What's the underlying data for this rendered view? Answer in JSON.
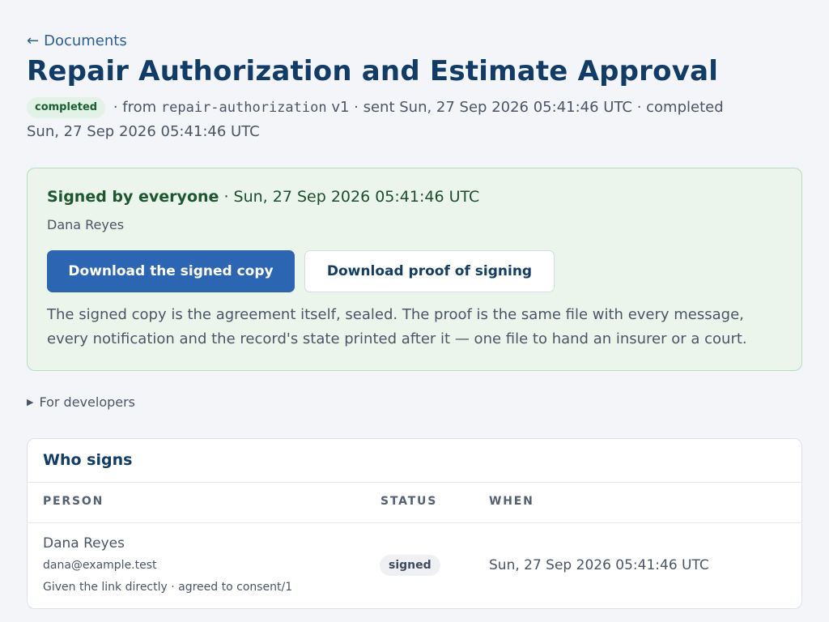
{
  "nav": {
    "back_arrow": "←",
    "back_label": "Documents"
  },
  "document": {
    "title": "Repair Authorization and Estimate Approval",
    "status": "completed",
    "from_prefix": " · from ",
    "template_name": "repair-authorization",
    "template_version": " v1",
    "sent_prefix": " · sent ",
    "sent_at": "Sun, 27 Sep 2026 05:41:46 UTC",
    "completed_prefix": " · completed ",
    "completed_at": "Sun, 27 Sep 2026 05:41:46 UTC"
  },
  "signed_panel": {
    "headline": "Signed by everyone",
    "separator": " · ",
    "signed_at": "Sun, 27 Sep 2026 05:41:46 UTC",
    "signer_names": "Dana Reyes",
    "download_signed_label": "Download the signed copy",
    "download_proof_label": "Download proof of signing",
    "explainer": "The signed copy is the agreement itself, sealed. The proof is the same file with every message, every notification and the record's state printed after it — one file to hand an insurer or a court."
  },
  "developers": {
    "caret_icon": "▶",
    "label": "For developers"
  },
  "signers": {
    "title": "Who signs",
    "columns": {
      "person": "PERSON",
      "status": "STATUS",
      "when": "WHEN"
    },
    "rows": [
      {
        "name": "Dana Reyes",
        "email": "dana@example.test",
        "note": "Given the link directly · agreed to consent/1",
        "status": "signed",
        "when": "Sun, 27 Sep 2026 05:41:46 UTC"
      }
    ]
  },
  "colors": {
    "background": "#f4f5f9",
    "title": "#123c68",
    "link": "#2b5e98",
    "primary_button": "#2c65b1",
    "success_panel": "#ebf5ec",
    "success_border": "#b8dcbf",
    "completed_badge": "#e2f2e6"
  }
}
